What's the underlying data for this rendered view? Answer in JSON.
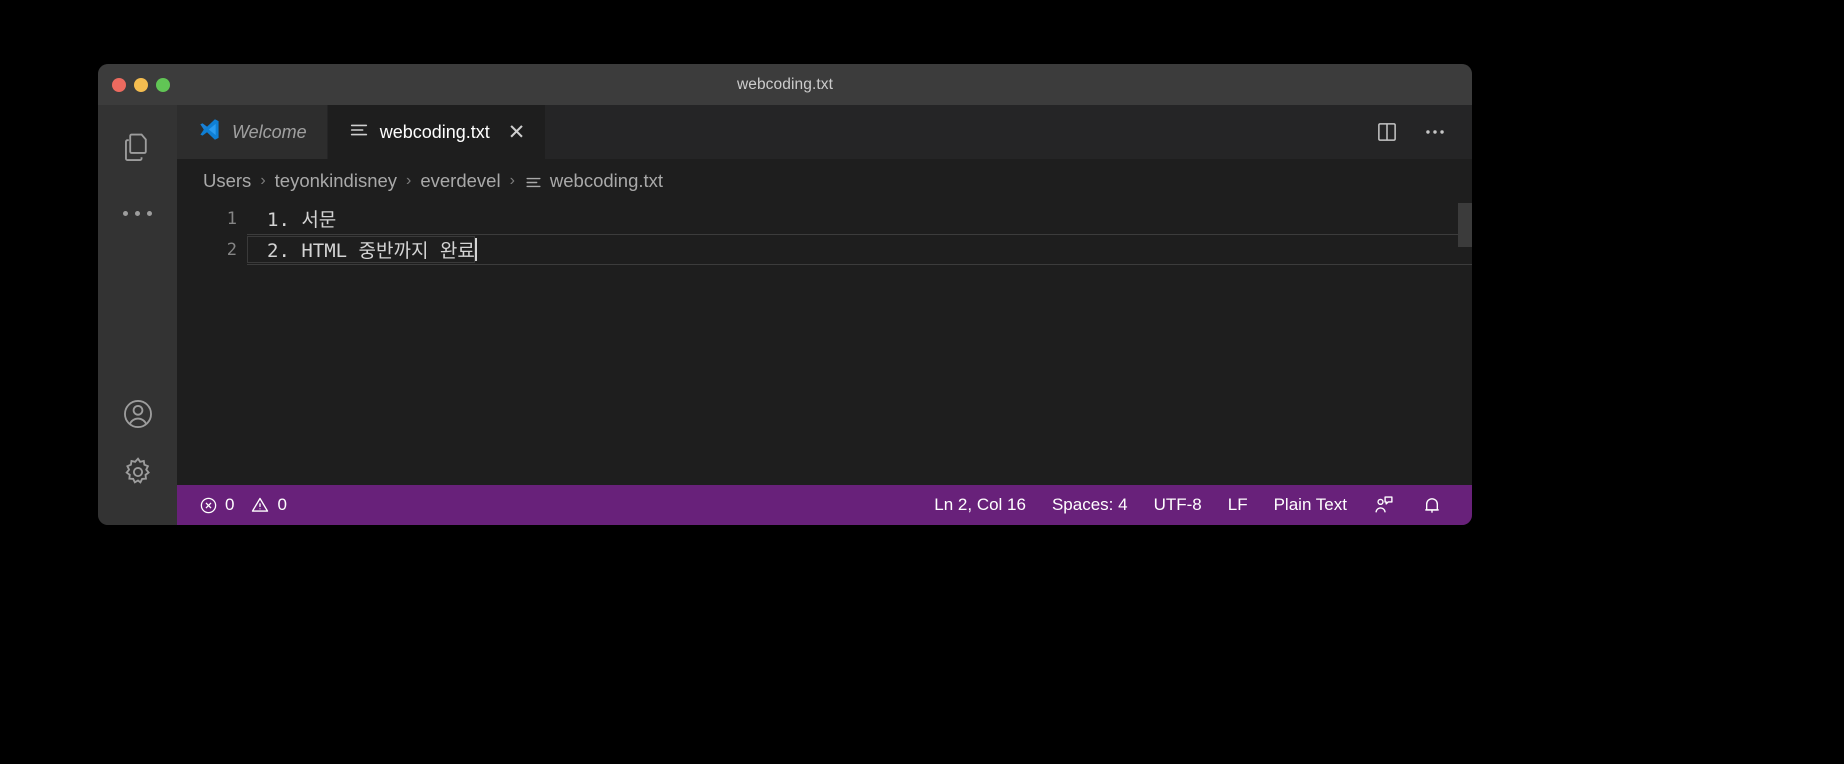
{
  "window": {
    "title": "webcoding.txt",
    "controls": [
      {
        "name": "close",
        "color": "#ec6a5f"
      },
      {
        "name": "minimize",
        "color": "#f4bd50"
      },
      {
        "name": "zoom",
        "color": "#61c555"
      }
    ]
  },
  "activity_bar": {
    "items": [
      {
        "icon": "explorer-files-icon",
        "label": "Explorer"
      },
      {
        "icon": "more-dots-icon",
        "label": "Additional Views"
      },
      {
        "icon": "account-icon",
        "label": "Accounts"
      },
      {
        "icon": "gear-icon",
        "label": "Manage"
      }
    ]
  },
  "tabs": [
    {
      "label": "Welcome",
      "icon": "vscode-logo-icon",
      "active": false,
      "closable": false
    },
    {
      "label": "webcoding.txt",
      "icon": "plain-text-file-icon",
      "active": true,
      "closable": true,
      "close_glyph": "✕"
    }
  ],
  "editor_actions": [
    {
      "icon": "split-editor-right-icon",
      "label": "Split Editor Right"
    },
    {
      "icon": "more-actions-icon",
      "label": "More Actions..."
    }
  ],
  "breadcrumbs": {
    "separator": "›",
    "items": [
      {
        "label": "Users",
        "icon": null
      },
      {
        "label": "teyonkindisney",
        "icon": null
      },
      {
        "label": "everdevel",
        "icon": null
      },
      {
        "label": "webcoding.txt",
        "icon": "plain-text-file-icon"
      }
    ]
  },
  "editor": {
    "lines": [
      {
        "number": "1",
        "text": "1. 서문",
        "current": false
      },
      {
        "number": "2",
        "text": "2. HTML 중반까지 완료",
        "current": true
      }
    ],
    "cursor_at_end_of_line": 2
  },
  "status_bar": {
    "background": "#68217a",
    "errors": {
      "icon": "error-circle-x-icon",
      "count": "0"
    },
    "warnings": {
      "icon": "warning-triangle-icon",
      "count": "0"
    },
    "right_items": [
      {
        "name": "cursor-position",
        "label": "Ln 2, Col 16"
      },
      {
        "name": "indentation",
        "label": "Spaces: 4"
      },
      {
        "name": "encoding",
        "label": "UTF-8"
      },
      {
        "name": "eol",
        "label": "LF"
      },
      {
        "name": "language-mode",
        "label": "Plain Text"
      }
    ],
    "right_icons": [
      {
        "icon": "feedback-person-icon",
        "label": "Tweet Feedback"
      },
      {
        "icon": "bell-notifications-icon",
        "label": "No Notifications"
      }
    ]
  }
}
